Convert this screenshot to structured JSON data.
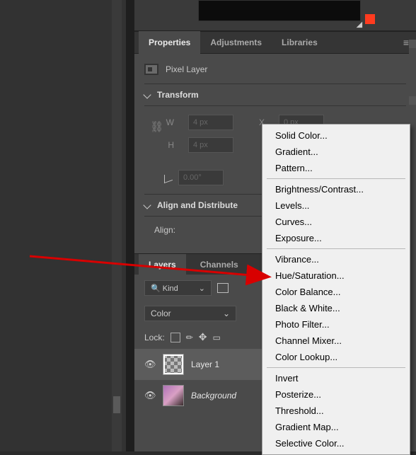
{
  "tabs": {
    "properties": "Properties",
    "adjustments": "Adjustments",
    "libraries": "Libraries"
  },
  "pixel_layer_label": "Pixel Layer",
  "sections": {
    "transform": "Transform",
    "align": "Align and Distribute",
    "align_label": "Align:"
  },
  "transform": {
    "w_label": "W",
    "w_value": "4 px",
    "h_label": "H",
    "h_value": "4 px",
    "x_label": "X",
    "x_value": "0 px",
    "angle_value": "0.00°"
  },
  "layers_panel": {
    "tab_layers": "Layers",
    "tab_channels": "Channels",
    "kind_search_icon": "🔍",
    "kind_label": "Kind",
    "blend_mode": "Color",
    "lock_label": "Lock:",
    "layers": [
      {
        "name": "Layer 1",
        "thumb": "checker",
        "selected": true
      },
      {
        "name": "Background",
        "thumb": "photo",
        "selected": false
      }
    ]
  },
  "context_menu": {
    "groups": [
      [
        "Solid Color...",
        "Gradient...",
        "Pattern..."
      ],
      [
        "Brightness/Contrast...",
        "Levels...",
        "Curves...",
        "Exposure..."
      ],
      [
        "Vibrance...",
        "Hue/Saturation...",
        "Color Balance...",
        "Black & White...",
        "Photo Filter...",
        "Channel Mixer...",
        "Color Lookup..."
      ],
      [
        "Invert",
        "Posterize...",
        "Threshold...",
        "Gradient Map...",
        "Selective Color..."
      ]
    ]
  }
}
